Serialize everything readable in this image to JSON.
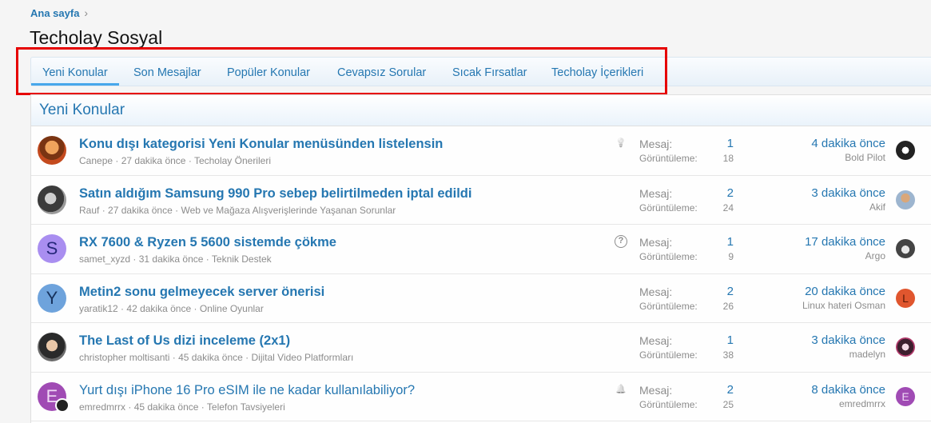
{
  "breadcrumb": {
    "home": "Ana sayfa",
    "chevron": "›"
  },
  "page": {
    "title": "Techolay Sosyal"
  },
  "tabs": [
    {
      "label": "Yeni Konular"
    },
    {
      "label": "Son Mesajlar"
    },
    {
      "label": "Popüler Konular"
    },
    {
      "label": "Cevapsız Sorular"
    },
    {
      "label": "Sıcak Fırsatlar"
    },
    {
      "label": "Techolay İçerikleri"
    }
  ],
  "block": {
    "heading": "Yeni Konular"
  },
  "labels": {
    "replies": "Mesaj:",
    "views": "Görüntüleme:"
  },
  "threads": [
    {
      "title": "Konu dışı kategorisi Yeni Konular menüsünden listelensin",
      "author": "Canepe",
      "time": "27 dakika önce",
      "forum": "Techolay Önerileri",
      "status_icon": "lightbulb-icon",
      "replies": "1",
      "views": "18",
      "last_time": "4 dakika önce",
      "last_user": "Bold Pilot",
      "avatar": "photo",
      "avatar_letter": "",
      "last_avatar_letter": ""
    },
    {
      "title": "Satın aldığım Samsung 990 Pro sebep belirtilmeden iptal edildi",
      "author": "Rauf",
      "time": "27 dakika önce",
      "forum": "Web ve Mağaza Alışverişlerinde Yaşanan Sorunlar",
      "status_icon": "",
      "replies": "2",
      "views": "24",
      "last_time": "3 dakika önce",
      "last_user": "Akif",
      "avatar": "photo",
      "avatar_letter": "",
      "last_avatar_letter": ""
    },
    {
      "title": "RX 7600 & Ryzen 5 5600 sistemde çökme",
      "author": "samet_xyzd",
      "time": "31 dakika önce",
      "forum": "Teknik Destek",
      "status_icon": "question-icon",
      "replies": "1",
      "views": "9",
      "last_time": "17 dakika önce",
      "last_user": "Argo",
      "avatar": "letter",
      "avatar_letter": "S",
      "last_avatar_letter": ""
    },
    {
      "title": "Metin2 sonu gelmeyecek server önerisi",
      "author": "yaratik12",
      "time": "42 dakika önce",
      "forum": "Online Oyunlar",
      "status_icon": "",
      "replies": "2",
      "views": "26",
      "last_time": "20 dakika önce",
      "last_user": "Linux hateri Osman",
      "avatar": "letter",
      "avatar_letter": "Y",
      "last_avatar_letter": "L"
    },
    {
      "title": "The Last of Us dizi inceleme (2x1)",
      "author": "christopher moltisanti",
      "time": "45 dakika önce",
      "forum": "Dijital Video Platformları",
      "status_icon": "",
      "replies": "1",
      "views": "38",
      "last_time": "3 dakika önce",
      "last_user": "madelyn",
      "avatar": "photo",
      "avatar_letter": "",
      "last_avatar_letter": ""
    },
    {
      "title": "Yurt dışı iPhone 16 Pro eSIM ile ne kadar kullanılabiliyor?",
      "author": "emredmrrx",
      "time": "45 dakika önce",
      "forum": "Telefon Tavsiyeleri",
      "status_icon": "bell-icon",
      "replies": "2",
      "views": "25",
      "last_time": "8 dakika önce",
      "last_user": "emredmrrx",
      "avatar": "letter",
      "avatar_letter": "E",
      "last_avatar_letter": "E",
      "read": true
    }
  ],
  "colors": {
    "link": "#2577b1",
    "muted": "#8c8c8c",
    "highlight_box": "#e60000",
    "tab_underline": "#47a7eb"
  }
}
